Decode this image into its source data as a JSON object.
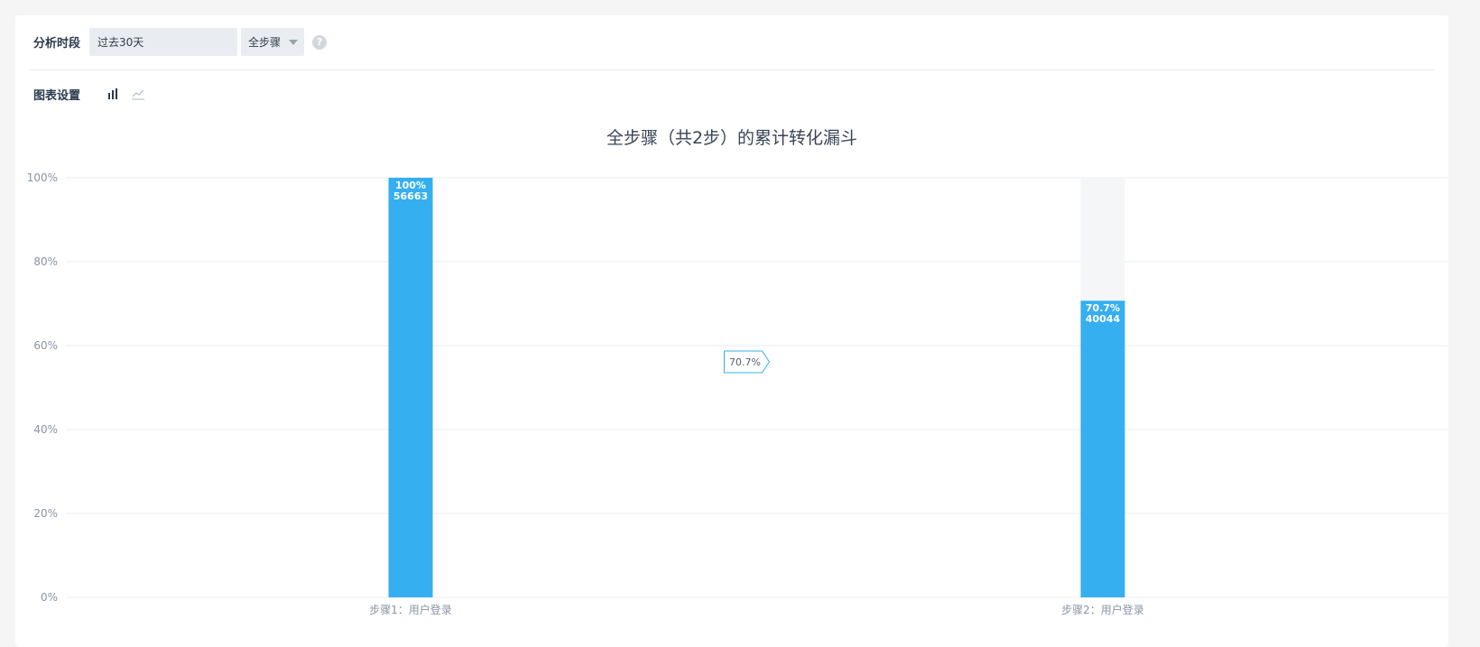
{
  "filters": {
    "period_label": "分析时段",
    "period_value": "过去30天",
    "steps_value": "全步骤",
    "help_glyph": "?"
  },
  "settings": {
    "label": "图表设置",
    "icons": [
      "bar-chart-icon",
      "line-chart-icon"
    ]
  },
  "colors": {
    "bar": "#35aff0",
    "bar_bg": "#f5f6f8",
    "grid": "#ebeef3",
    "conv_border": "#35aff0"
  },
  "chart_data": {
    "type": "bar",
    "title": "全步骤（共2步）的累计转化漏斗",
    "categories": [
      "步骤1：用户登录",
      "步骤2：用户登录"
    ],
    "values": [
      100,
      70.7
    ],
    "counts": [
      56663,
      40044
    ],
    "value_labels": [
      "100%",
      "70.7%"
    ],
    "count_labels": [
      "56663",
      "40044"
    ],
    "conversion_labels": [
      "70.7%"
    ],
    "y_ticks": [
      "0%",
      "20%",
      "40%",
      "60%",
      "80%",
      "100%"
    ],
    "ylim": [
      0,
      100
    ],
    "xlabel": "",
    "ylabel": "",
    "grid": true
  }
}
